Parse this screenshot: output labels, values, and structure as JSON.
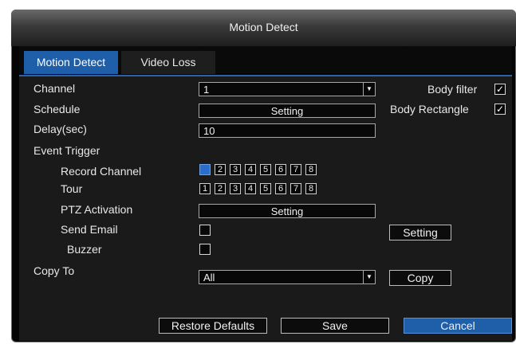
{
  "window": {
    "title": "Motion Detect"
  },
  "tabs": [
    {
      "label": "Motion Detect",
      "active": true
    },
    {
      "label": "Video Loss",
      "active": false
    }
  ],
  "form": {
    "channel": {
      "label": "Channel",
      "value": "1"
    },
    "schedule": {
      "label": "Schedule",
      "button": "Setting"
    },
    "delay": {
      "label": "Delay(sec)",
      "value": "10"
    },
    "event_trigger": {
      "label": "Event Trigger"
    },
    "record_channel": {
      "label": "Record Channel",
      "channels": [
        "1",
        "2",
        "3",
        "4",
        "5",
        "6",
        "7",
        "8"
      ],
      "selected": [
        1
      ]
    },
    "tour": {
      "label": "Tour",
      "channels": [
        "1",
        "2",
        "3",
        "4",
        "5",
        "6",
        "7",
        "8"
      ],
      "selected": []
    },
    "ptz": {
      "label": "PTZ Activation",
      "button": "Setting"
    },
    "send_email": {
      "label": "Send Email",
      "checked": false,
      "button": "Setting"
    },
    "buzzer": {
      "label": "Buzzer",
      "checked": false
    },
    "copy_to": {
      "label": "Copy To",
      "value": "All",
      "button": "Copy"
    },
    "body_filter": {
      "label": "Body filter",
      "checked": true
    },
    "body_rectangle": {
      "label": "Body Rectangle",
      "checked": true
    }
  },
  "footer": {
    "restore": "Restore Defaults",
    "save": "Save",
    "cancel": "Cancel"
  },
  "icons": {
    "checkbox_check": "check-icon",
    "dropdown": "dropdown-arrow-icon"
  },
  "colors": {
    "accent": "#1f5ea8",
    "background": "#1a1a1a"
  }
}
